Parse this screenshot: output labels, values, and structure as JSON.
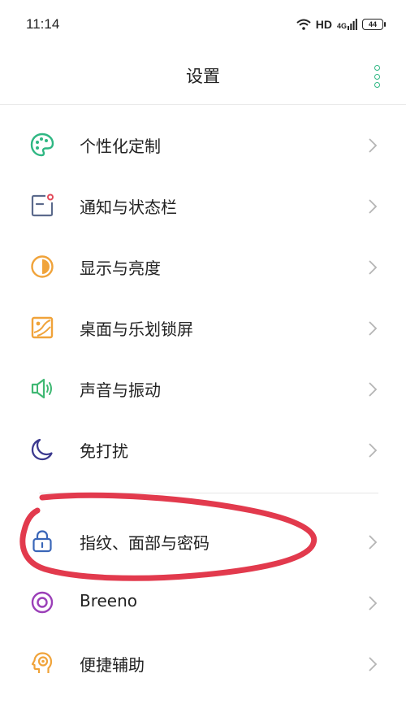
{
  "status": {
    "time": "11:14",
    "hd": "HD",
    "network": "4G",
    "battery": "44"
  },
  "header": {
    "title": "设置"
  },
  "items": [
    {
      "label": "个性化定制",
      "icon": "palette-icon",
      "color": "#2fb783"
    },
    {
      "label": "通知与状态栏",
      "icon": "notification-icon",
      "color": "#5b6a8c"
    },
    {
      "label": "显示与亮度",
      "icon": "brightness-icon",
      "color": "#f0a33a"
    },
    {
      "label": "桌面与乐划锁屏",
      "icon": "wallpaper-icon",
      "color": "#f0a33a"
    },
    {
      "label": "声音与振动",
      "icon": "speaker-icon",
      "color": "#3fb873"
    },
    {
      "label": "免打扰",
      "icon": "moon-icon",
      "color": "#3c3a8f"
    },
    {
      "label": "指纹、面部与密码",
      "icon": "lock-icon",
      "color": "#3a66b8"
    },
    {
      "label": "Breeno",
      "icon": "breeno-icon",
      "color": "#9b3fb8"
    },
    {
      "label": "便捷辅助",
      "icon": "assist-head-icon",
      "color": "#f0a33a"
    }
  ],
  "annotation_color": "#e23a4d"
}
